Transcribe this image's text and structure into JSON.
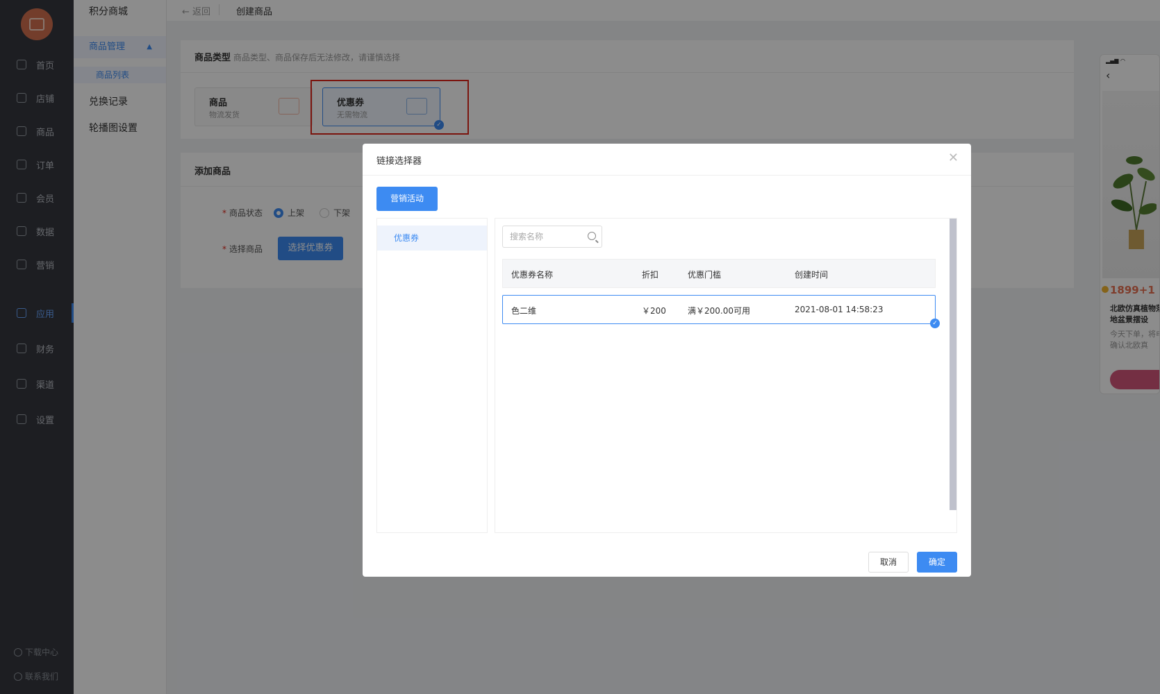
{
  "nav": {
    "items": [
      {
        "label": "首页",
        "icon": "home-icon"
      },
      {
        "label": "店铺",
        "icon": "store-icon"
      },
      {
        "label": "商品",
        "icon": "goods-icon"
      },
      {
        "label": "订单",
        "icon": "order-icon"
      },
      {
        "label": "会员",
        "icon": "member-icon"
      },
      {
        "label": "数据",
        "icon": "data-icon"
      },
      {
        "label": "营销",
        "icon": "tag-icon"
      },
      {
        "label": "应用",
        "icon": "app-icon"
      },
      {
        "label": "财务",
        "icon": "finance-icon"
      },
      {
        "label": "渠道",
        "icon": "channel-icon"
      },
      {
        "label": "设置",
        "icon": "settings-icon"
      }
    ],
    "active": "应用",
    "footer": {
      "download": "下载中心",
      "contact": "联系我们"
    }
  },
  "subnav": {
    "title": "积分商城",
    "group": "商品管理",
    "group_item": "商品列表",
    "links": [
      "兑换记录",
      "轮播图设置"
    ]
  },
  "topbar": {
    "back": "← 返回",
    "crumb": "创建商品"
  },
  "product_type": {
    "title": "商品类型",
    "hint": "商品类型、商品保存后无法修改，请谨慎选择",
    "options": [
      {
        "name": "商品",
        "desc": "物流发货"
      },
      {
        "name": "优惠券",
        "desc": "无需物流"
      }
    ],
    "selected": "优惠券"
  },
  "add_product": {
    "title": "添加商品",
    "status_label": "商品状态",
    "status_on": "上架",
    "status_off": "下架",
    "select_label": "选择商品",
    "select_button": "选择优惠券"
  },
  "phone_preview": {
    "price": "1899+1",
    "name": "北欧仿真植物落地盆景摆设",
    "desc": "今天下单，将电确认北欧真"
  },
  "dialog": {
    "title": "链接选择器",
    "tab": "营销活动",
    "category": "优惠券",
    "search_placeholder": "搜索名称",
    "columns": [
      "优惠券名称",
      "折扣",
      "优惠门槛",
      "创建时间"
    ],
    "rows": [
      {
        "name": "色二维",
        "discount": "￥200",
        "threshold": "满￥200.00可用",
        "created": "2021-08-01 14:58:23"
      }
    ],
    "cancel": "取消",
    "confirm": "确定"
  },
  "colors": {
    "accent": "#3d8bf2",
    "nav_bg": "#35383f",
    "highlight": "#e0261b"
  }
}
